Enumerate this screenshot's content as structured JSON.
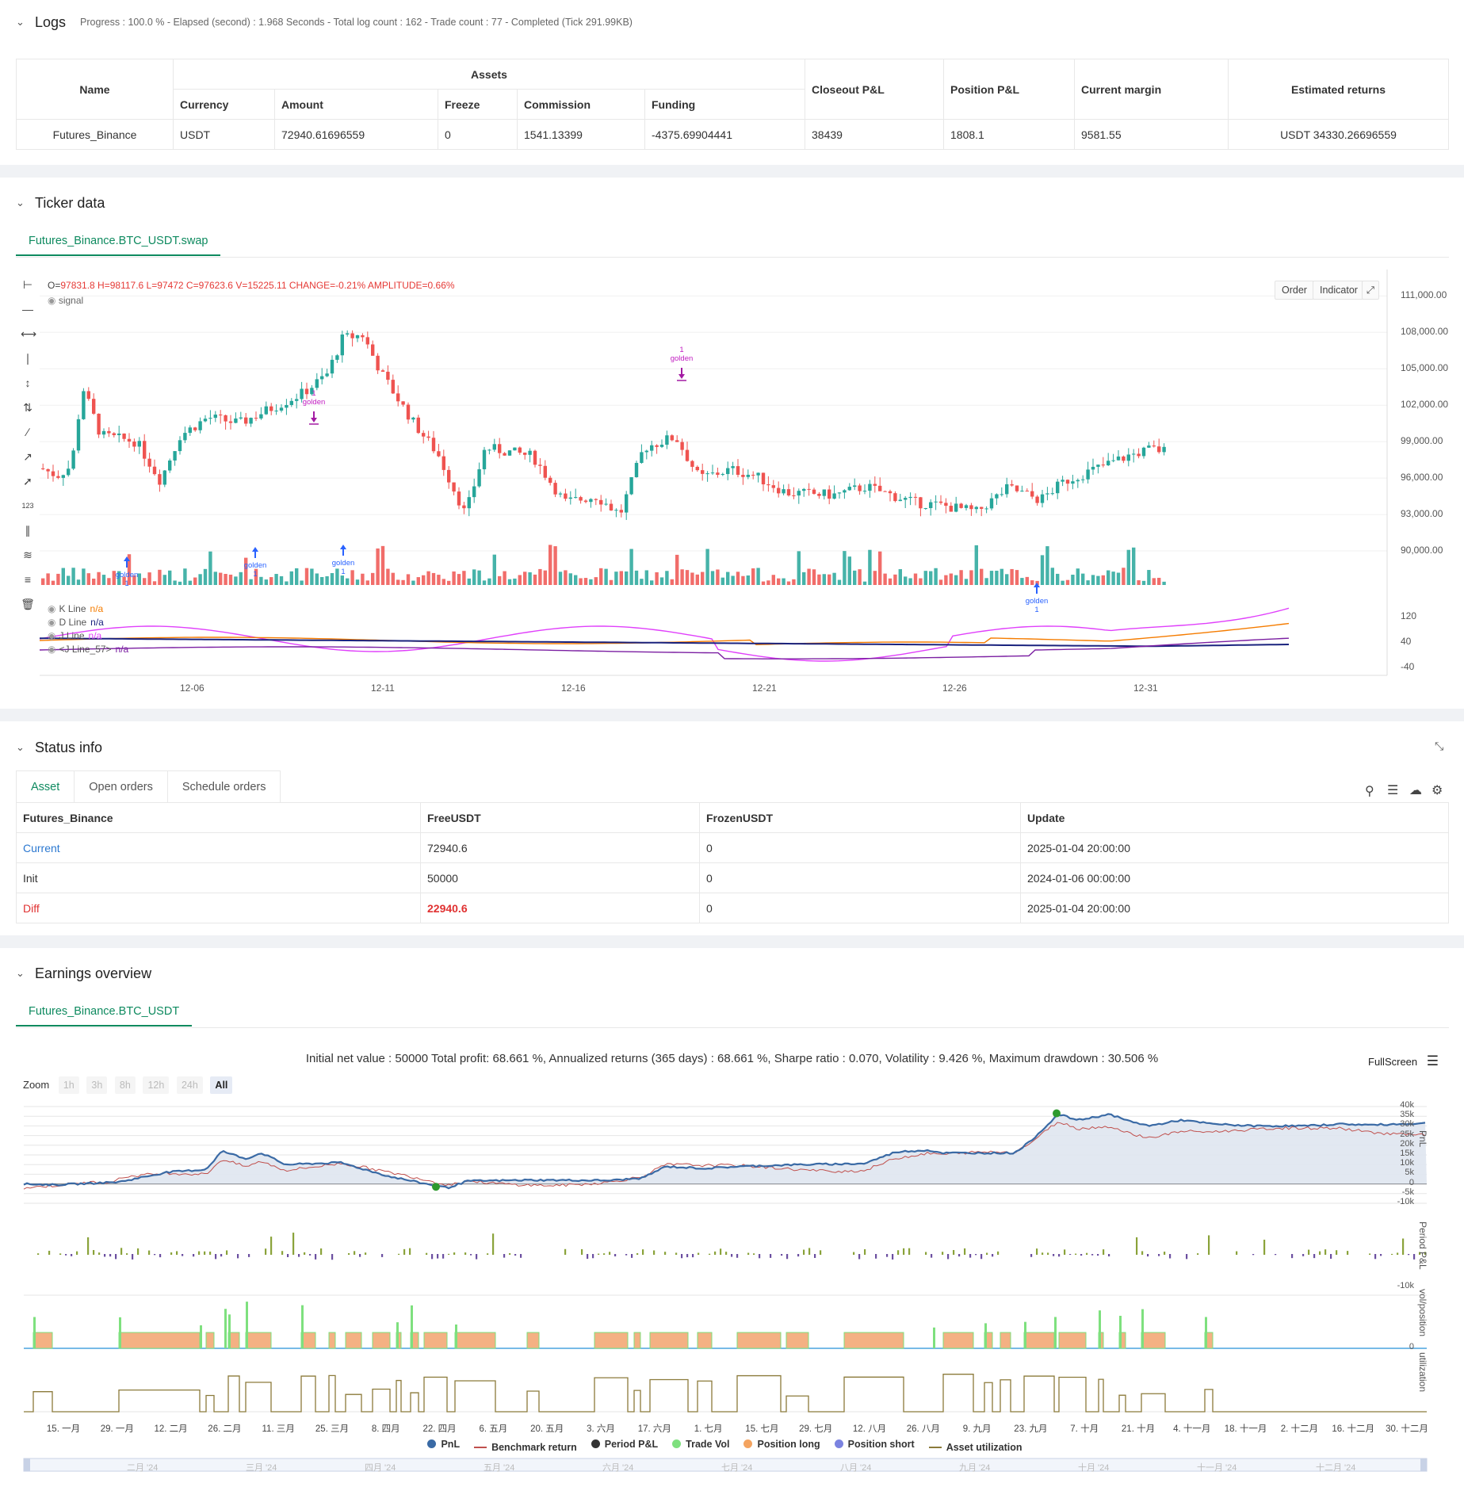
{
  "logs": {
    "title": "Logs",
    "info": "Progress : 100.0 % - Elapsed (second) : 1.968  Seconds - Total log count : 162 - Trade count : 77 - Completed (Tick 291.99KB)"
  },
  "assets_table": {
    "name_header": "Name",
    "assets_header": "Assets",
    "currency_header": "Currency",
    "amount_header": "Amount",
    "freeze_header": "Freeze",
    "commission_header": "Commission",
    "funding_header": "Funding",
    "closeout_header": "Closeout P&L",
    "position_header": "Position P&L",
    "margin_header": "Current margin",
    "returns_header": "Estimated returns",
    "row": {
      "name": "Futures_Binance",
      "currency": "USDT",
      "amount": "72940.61696559",
      "freeze": "0",
      "commission": "1541.13399",
      "funding": "-4375.69904441",
      "closeout": "38439",
      "position": "1808.1",
      "margin": "9581.55",
      "returns": "USDT 34330.26696559"
    }
  },
  "ticker": {
    "title": "Ticker data",
    "tab": "Futures_Binance.BTC_USDT.swap",
    "ohlc_prefix": "O=",
    "ohlc_values": "97831.8 H=98117.6 L=97472 C=97623.6 V=15225.11 CHANGE=-0.21% AMPLITUDE=0.66%",
    "signal_label": "signal",
    "order_btn": "Order",
    "indicator_btn": "Indicator",
    "price_axis": [
      "111,000.00",
      "108,000.00",
      "105,000.00",
      "102,000.00",
      "99,000.00",
      "96,000.00",
      "93,000.00",
      "90,000.00"
    ],
    "osc_axis": [
      "120",
      "40",
      "-40"
    ],
    "date_axis": [
      "12-06",
      "12-11",
      "12-16",
      "12-21",
      "12-26",
      "12-31"
    ],
    "indicators": [
      {
        "name": "K Line",
        "value": "n/a"
      },
      {
        "name": "D Line",
        "value": "n/a"
      },
      {
        "name": "J Line",
        "value": "n/a"
      },
      {
        "name": "<J Line_57>",
        "value": "n/a"
      }
    ],
    "signal_text": "golden",
    "signal_count": "1",
    "colors": {
      "up": "#26a69a",
      "down": "#ef5350",
      "k": "#f57c00",
      "d": "#1a237e",
      "j": "#e040fb",
      "j57": "#7b1fa2"
    }
  },
  "status": {
    "title": "Status info",
    "tabs": [
      "Asset",
      "Open orders",
      "Schedule orders"
    ],
    "headers": [
      "Futures_Binance",
      "FreeUSDT",
      "FrozenUSDT",
      "Update"
    ],
    "rows": [
      [
        "Current",
        "72940.6",
        "0",
        "2025-01-04 20:00:00"
      ],
      [
        "Init",
        "50000",
        "0",
        "2024-01-06 00:00:00"
      ],
      [
        "Diff",
        "22940.6",
        "0",
        "2025-01-04 20:00:00"
      ]
    ]
  },
  "earnings": {
    "title": "Earnings overview",
    "tab": "Futures_Binance.BTC_USDT",
    "summary": "Initial net value : 50000  Total profit: 68.661 %, Annualized returns (365 days) : 68.661 %, Sharpe ratio : 0.070, Volatility : 9.426 %, Maximum drawdown : 30.506 %",
    "fullscreen": "FullScreen",
    "zoom_label": "Zoom",
    "zoom_options": [
      "1h",
      "3h",
      "8h",
      "12h",
      "24h",
      "All"
    ],
    "pnl_axis": [
      "40k",
      "35k",
      "30k",
      "25k",
      "20k",
      "15k",
      "10k",
      "5k",
      "0",
      "-5k",
      "-10k"
    ],
    "period_axis": [
      "-10k"
    ],
    "pos_axis": [
      "0"
    ],
    "axis_titles": [
      "PnL",
      "Period P&L",
      "vol/position",
      "utilization"
    ],
    "x_axis": [
      "15. 一月",
      "29. 一月",
      "12. 二月",
      "26. 二月",
      "11. 三月",
      "25. 三月",
      "8. 四月",
      "22. 四月",
      "6. 五月",
      "20. 五月",
      "3. 六月",
      "17. 六月",
      "1. 七月",
      "15. 七月",
      "29. 七月",
      "12. 八月",
      "26. 八月",
      "9. 九月",
      "23. 九月",
      "7. 十月",
      "21. 十月",
      "4. 十一月",
      "18. 十一月",
      "2. 十二月",
      "16. 十二月",
      "30. 十二月"
    ],
    "navigator_axis": [
      "二月 '24",
      "三月 '24",
      "四月 '24",
      "五月 '24",
      "六月 '24",
      "七月 '24",
      "八月 '24",
      "九月 '24",
      "十月 '24",
      "十一月 '24",
      "十二月 '24"
    ],
    "legend": [
      {
        "label": "PnL",
        "color": "#3a6aa5",
        "kind": "dot"
      },
      {
        "label": "Benchmark return",
        "color": "#c0504d",
        "kind": "dash"
      },
      {
        "label": "Period P&L",
        "color": "#333333",
        "kind": "dot"
      },
      {
        "label": "Trade Vol",
        "color": "#7ee07e",
        "kind": "dot"
      },
      {
        "label": "Position long",
        "color": "#f4a460",
        "kind": "dot"
      },
      {
        "label": "Position short",
        "color": "#7b83e0",
        "kind": "dot"
      },
      {
        "label": "Asset utilization",
        "color": "#8b7a3a",
        "kind": "dash"
      }
    ]
  }
}
